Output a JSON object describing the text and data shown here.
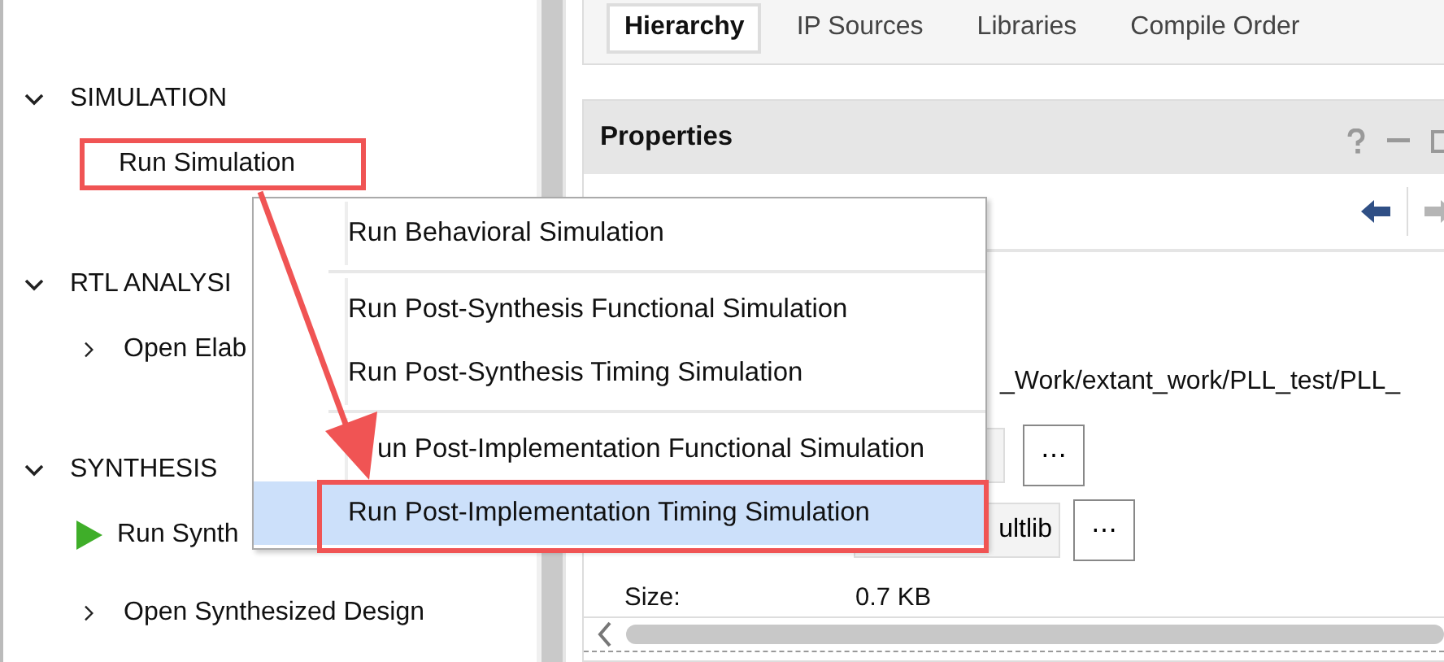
{
  "flow_navigator": {
    "sections": [
      {
        "title": "SIMULATION",
        "expanded": true,
        "items": [
          {
            "label": "Run Simulation",
            "kind": "plain"
          }
        ]
      },
      {
        "title": "RTL ANALYSI",
        "expanded": true,
        "items": [
          {
            "label": "Open Elab",
            "kind": "expandable",
            "expanded": false
          }
        ]
      },
      {
        "title": "SYNTHESIS",
        "expanded": true,
        "items": [
          {
            "label": "Run Synth",
            "kind": "run"
          },
          {
            "label": "Open Synthesized Design",
            "kind": "expandable",
            "expanded": false
          }
        ]
      }
    ]
  },
  "tabs": [
    {
      "label": "Hierarchy",
      "selected": true
    },
    {
      "label": "IP Sources",
      "selected": false
    },
    {
      "label": "Libraries",
      "selected": false
    },
    {
      "label": "Compile Order",
      "selected": false
    }
  ],
  "properties": {
    "title": "Properties",
    "path": "_Work/extant_work/PLL_test/PLL_",
    "browse_button": "⋯",
    "library_button": "ultlib",
    "library_browse_button": "⋯",
    "size_label": "Size:",
    "size_value": "0.7 KB"
  },
  "context_menu": {
    "groups": [
      {
        "items": [
          {
            "label": "Run Behavioral Simulation",
            "kind": "plain",
            "selected": false
          }
        ]
      },
      {
        "items": [
          {
            "label": "Run Post-Synthesis Functional Simulation",
            "kind": "plain",
            "selected": false
          },
          {
            "label": "Run Post-Synthesis Timing Simulation",
            "kind": "plain",
            "selected": false
          }
        ]
      },
      {
        "items": [
          {
            "label": "un Post-Implementation Functional Simulation",
            "kind": "partly_covered",
            "selected": false
          },
          {
            "label": "Run Post-Implementation Timing Simulation",
            "kind": "plain",
            "selected": true
          }
        ]
      }
    ]
  }
}
